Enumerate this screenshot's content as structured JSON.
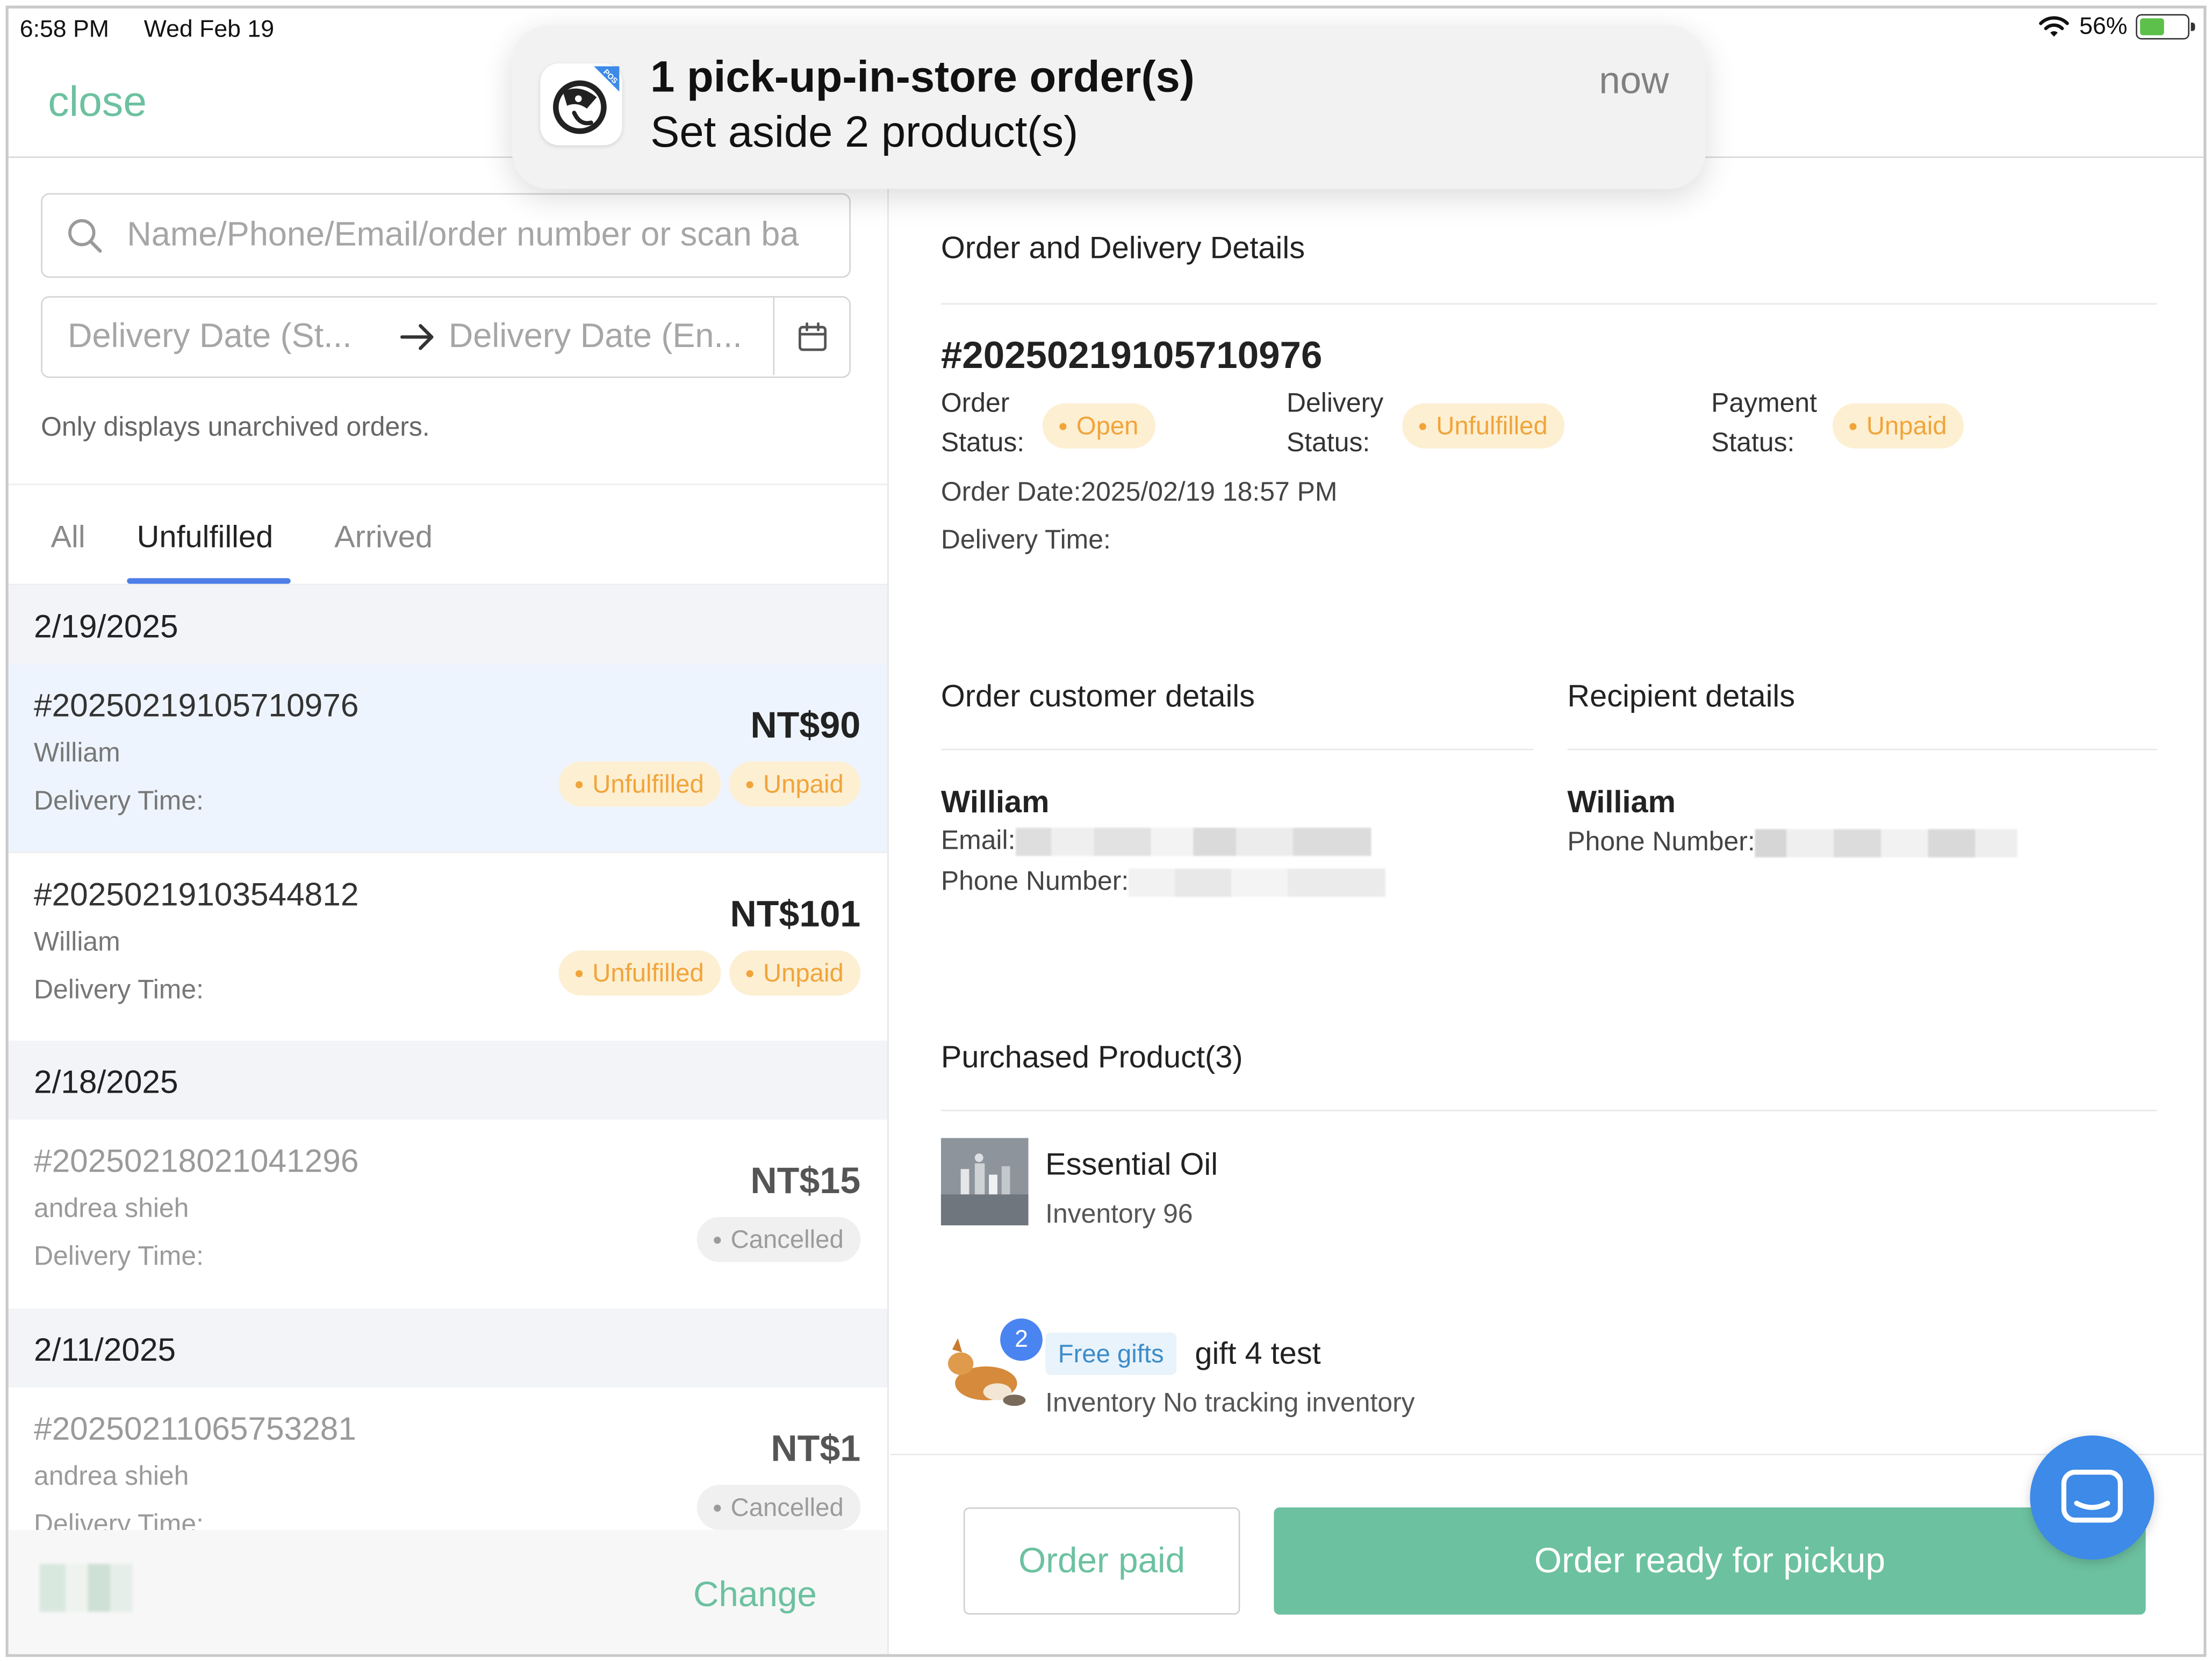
{
  "status_bar": {
    "time": "6:58 PM",
    "date": "Wed Feb 19",
    "battery": "56%",
    "battery_level": 0.56
  },
  "top_bar": {
    "close_label": "close"
  },
  "notification": {
    "title": "1 pick-up-in-store order(s)",
    "body": "Set aside 2 product(s)",
    "time": "now",
    "app_badge": "POS"
  },
  "sidebar": {
    "search_placeholder": "Name/Phone/Email/order number or scan ba",
    "date_start_placeholder": "Delivery Date (St...",
    "date_end_placeholder": "Delivery Date (En...",
    "note": "Only displays unarchived orders.",
    "tabs": [
      {
        "label": "All",
        "active": false
      },
      {
        "label": "Unfulfilled",
        "active": true
      },
      {
        "label": "Arrived",
        "active": false
      }
    ],
    "groups": [
      {
        "date": "2/19/2025",
        "orders": [
          {
            "number": "#20250219105710976",
            "name": "William",
            "delivery_time": "Delivery Time:",
            "price": "NT$90",
            "badges": [
              "Unfulfilled",
              "Unpaid"
            ],
            "selected": true,
            "muted": false
          },
          {
            "number": "#20250219103544812",
            "name": "William",
            "delivery_time": "Delivery Time:",
            "price": "NT$101",
            "badges": [
              "Unfulfilled",
              "Unpaid"
            ],
            "selected": false,
            "muted": false
          }
        ]
      },
      {
        "date": "2/18/2025",
        "orders": [
          {
            "number": "#20250218021041296",
            "name": "andrea shieh",
            "delivery_time": "Delivery Time:",
            "price": "NT$15",
            "badges": [
              "Cancelled"
            ],
            "selected": false,
            "muted": true
          }
        ]
      },
      {
        "date": "2/11/2025",
        "orders": [
          {
            "number": "#20250211065753281",
            "name": "andrea shieh",
            "delivery_time": "Delivery Time:",
            "price": "NT$1",
            "badges": [
              "Cancelled"
            ],
            "selected": false,
            "muted": true
          }
        ]
      }
    ],
    "footer": {
      "change_label": "Change"
    }
  },
  "detail": {
    "section_title": "Order and Delivery Details",
    "order_number": "#20250219105710976",
    "order_status_label": [
      "Order",
      "Status:"
    ],
    "order_status": "Open",
    "delivery_status_label": [
      "Delivery",
      "Status:"
    ],
    "delivery_status": "Unfulfilled",
    "payment_status_label": [
      "Payment",
      "Status:"
    ],
    "payment_status": "Unpaid",
    "order_date": "Order Date:2025/02/19 18:57 PM",
    "delivery_time": "Delivery Time:",
    "customer": {
      "title": "Order customer details",
      "name": "William",
      "email_label": "Email:",
      "phone_label": "Phone Number:"
    },
    "recipient": {
      "title": "Recipient details",
      "name": "William",
      "phone_label": "Phone Number:"
    },
    "products": {
      "title": "Purchased Product(3)",
      "items": [
        {
          "name": "Essential Oil",
          "inventory": "Inventory 96",
          "tag": "",
          "qty": ""
        },
        {
          "name": "gift 4 test",
          "inventory": "Inventory No tracking inventory",
          "tag": "Free gifts",
          "qty": "2"
        }
      ]
    },
    "actions": {
      "paid_label": "Order paid",
      "pickup_label": "Order ready for pickup"
    }
  },
  "colors": {
    "accent_green": "#6cc1a0",
    "warn_orange": "#f1a43a",
    "tab_blue": "#4f7ee8",
    "chat_blue": "#3d8ae8"
  }
}
